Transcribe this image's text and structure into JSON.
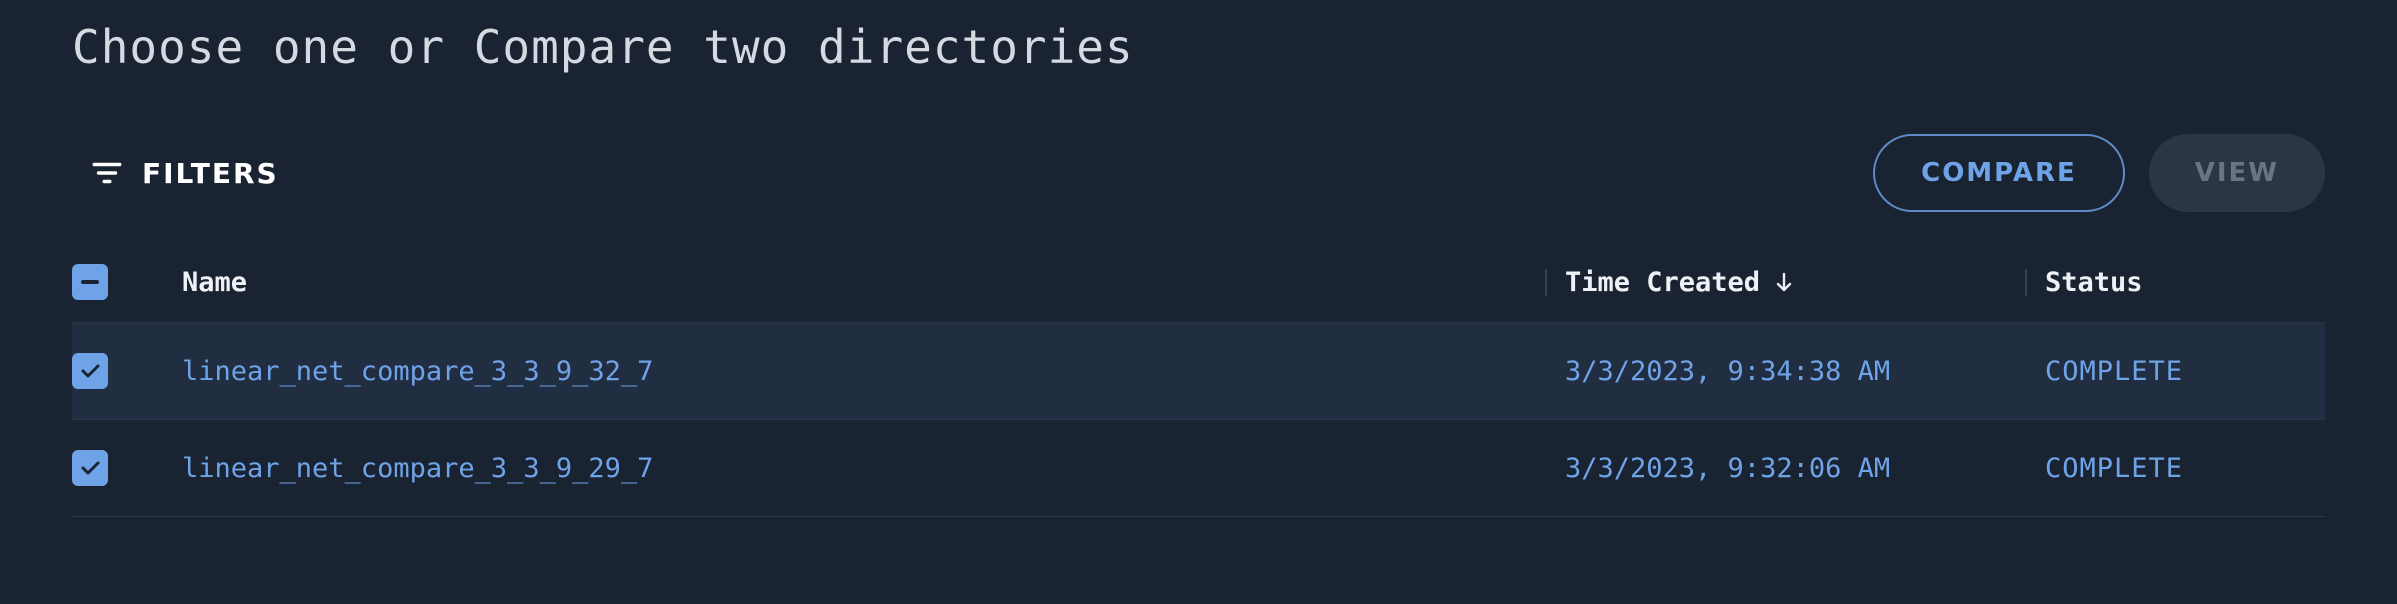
{
  "page_title": "Choose one or Compare two directories",
  "toolbar": {
    "filters_label": "FILTERS",
    "compare_label": "COMPARE",
    "view_label": "VIEW"
  },
  "table": {
    "columns": {
      "name": "Name",
      "time_created": "Time Created",
      "status": "Status"
    },
    "sort": {
      "column": "time_created",
      "direction": "desc"
    },
    "header_checkbox_state": "indeterminate",
    "rows": [
      {
        "checked": true,
        "name": "linear_net_compare_3_3_9_32_7",
        "time_created": "3/3/2023, 9:34:38 AM",
        "status": "COMPLETE",
        "selected": true
      },
      {
        "checked": true,
        "name": "linear_net_compare_3_3_9_29_7",
        "time_created": "3/3/2023, 9:32:06 AM",
        "status": "COMPLETE",
        "selected": false
      }
    ]
  }
}
